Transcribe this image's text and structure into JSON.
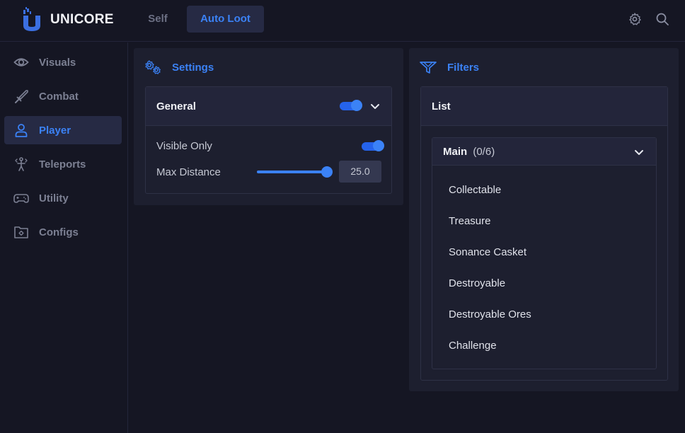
{
  "app": {
    "brand": "UNICORE",
    "accent": "#3b82f6"
  },
  "tabs": [
    {
      "label": "Self",
      "active": false
    },
    {
      "label": "Auto Loot",
      "active": true
    }
  ],
  "top_icons": [
    "gear-icon",
    "search-icon"
  ],
  "sidebar": {
    "items": [
      {
        "label": "Visuals",
        "icon": "eye-icon",
        "active": false
      },
      {
        "label": "Combat",
        "icon": "sword-icon",
        "active": false
      },
      {
        "label": "Player",
        "icon": "user-icon",
        "active": true
      },
      {
        "label": "Teleports",
        "icon": "person-arrows-icon",
        "active": false
      },
      {
        "label": "Utility",
        "icon": "gamepad-icon",
        "active": false
      },
      {
        "label": "Configs",
        "icon": "folder-gear-icon",
        "active": false
      }
    ]
  },
  "settings": {
    "title": "Settings",
    "general": {
      "title": "General",
      "enabled": true,
      "visible_only": {
        "label": "Visible Only",
        "enabled": true
      },
      "max_distance": {
        "label": "Max Distance",
        "value": "25.0",
        "fraction": 1.0
      }
    }
  },
  "filters": {
    "title": "Filters",
    "list": {
      "title": "List",
      "dropdown": {
        "label": "Main",
        "count": "(0/6)",
        "items": [
          "Collectable",
          "Treasure",
          "Sonance Casket",
          "Destroyable",
          "Destroyable Ores",
          "Challenge"
        ]
      }
    }
  }
}
